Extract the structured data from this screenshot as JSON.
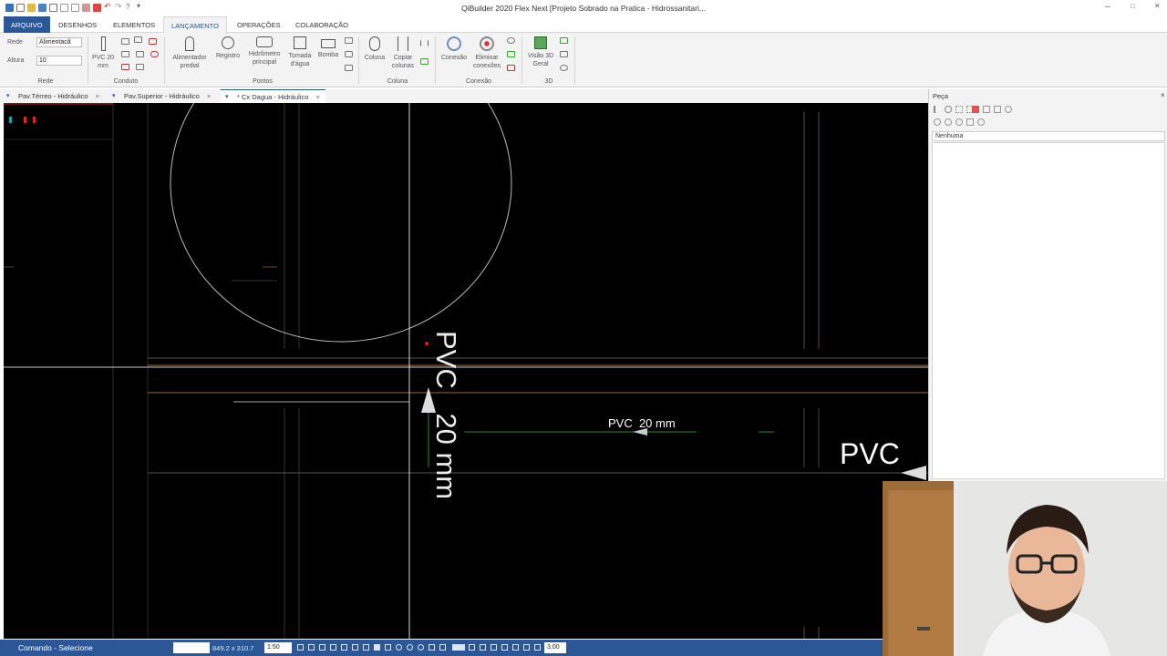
{
  "window": {
    "title": "QiBuilder 2020 Flex Next [Projeto Sobrado na Pratica - Hidrossanitari...",
    "controls": [
      "–",
      "□",
      "✕"
    ]
  },
  "ribbon_tabs": [
    "ARQUIVO",
    "DESENHOS",
    "ELEMENTOS",
    "LANÇAMENTO",
    "OPERAÇÕES",
    "COLABORAÇÃO"
  ],
  "ribbon": {
    "rede": {
      "label": "Rede",
      "value": "Alimentacã"
    },
    "altura": {
      "label": "Altura",
      "value": "10"
    },
    "conduto_button": "PVC 20 mm",
    "pontos_buttons": [
      "Alimentador predial",
      "Registro",
      "Hidrômetro principal",
      "Tomada d'água",
      "Bomba"
    ],
    "coluna_buttons": [
      "Coluna",
      "Copiar colunas"
    ],
    "conexao_buttons": [
      "Conexão",
      "Eliminar conexões"
    ],
    "view_button": "Visão 3D Geral",
    "groups": [
      "Rede",
      "Conduto",
      "Pontos",
      "Coluna",
      "Conexão",
      "3D"
    ]
  },
  "doc_tabs": [
    {
      "label": "Pav.Térreo - Hidráulico",
      "close": "×"
    },
    {
      "label": "Pav.Superior - Hidráulico",
      "close": "×"
    },
    {
      "label": "* Cx Dagua - Hidráulico",
      "close": "×"
    }
  ],
  "canvas": {
    "labels": {
      "vertical": "PVC 20 mm",
      "vertical_top": "PVC",
      "vertical_bottom": "20 mm",
      "horizontal": "PVC  20 mm",
      "right": "PVC"
    },
    "colors": {
      "background": "#000000",
      "lines": "#ffffff",
      "accent_orange": "#c98a3a",
      "accent_green": "#2a8a2a",
      "accent_red": "#e01818"
    }
  },
  "panel": {
    "title": "Peça",
    "close": "×",
    "filter": "Nenhuma"
  },
  "status": {
    "command": "Comando - Selecione",
    "coords": "849.2 x 310.7",
    "scale": "1:50",
    "zoom": "3,00"
  }
}
